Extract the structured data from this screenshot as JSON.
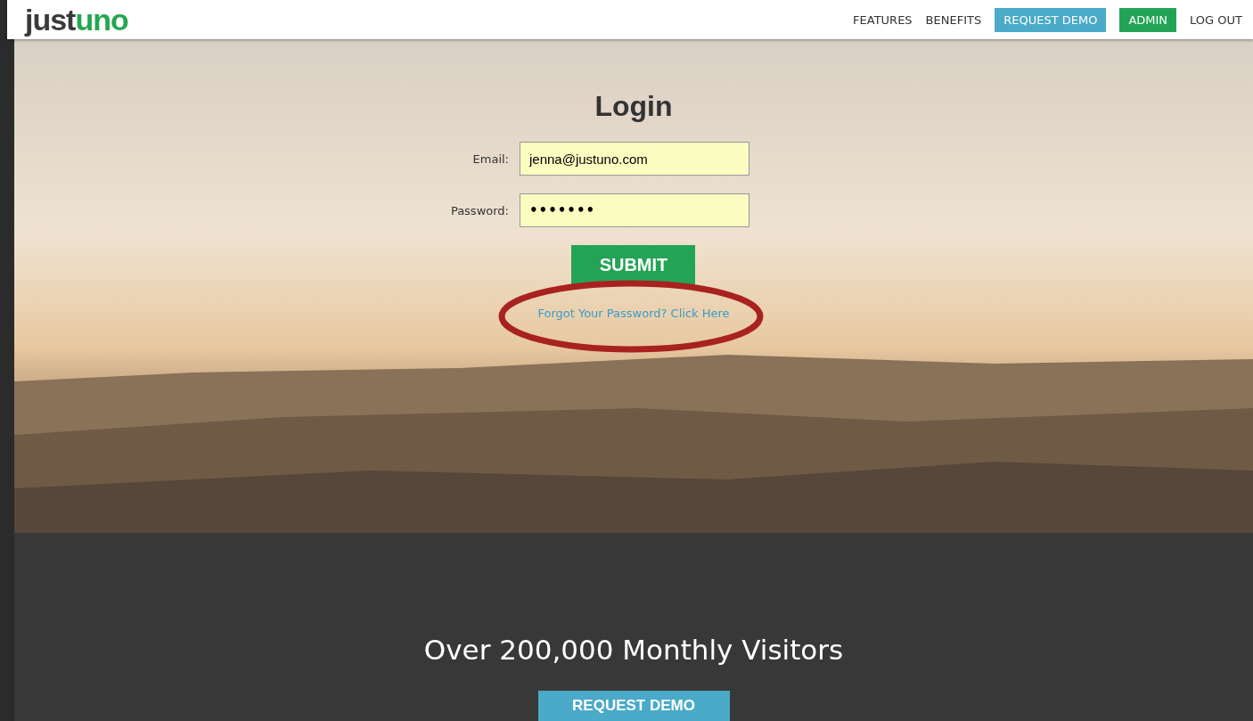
{
  "header": {
    "logo": [
      {
        "text": "just",
        "kind": "dark"
      },
      {
        "text": "uno",
        "kind": "accent"
      }
    ],
    "nav": [
      {
        "label": "FEATURES",
        "kind": "plain"
      },
      {
        "label": "BENEFITS",
        "kind": "plain"
      },
      {
        "label": "REQUEST DEMO",
        "kind": "blue"
      },
      {
        "label": "ADMIN",
        "kind": "green"
      },
      {
        "label": "LOG OUT",
        "kind": "plain"
      }
    ]
  },
  "login": {
    "title": "Login",
    "fields": [
      {
        "label": "Email:",
        "value": "jenna@justuno.com",
        "kind": "text"
      },
      {
        "label": "Password:",
        "value": "•••••••",
        "kind": "password"
      }
    ],
    "submit": "SUBMIT",
    "forgot_link": "Forgot Your Password? Click Here",
    "annotation": {
      "kind": "ellipse",
      "color": "#a8221f"
    }
  },
  "stats": {
    "headline": "Over 200,000 Monthly Visitors",
    "button": "REQUEST DEMO"
  }
}
